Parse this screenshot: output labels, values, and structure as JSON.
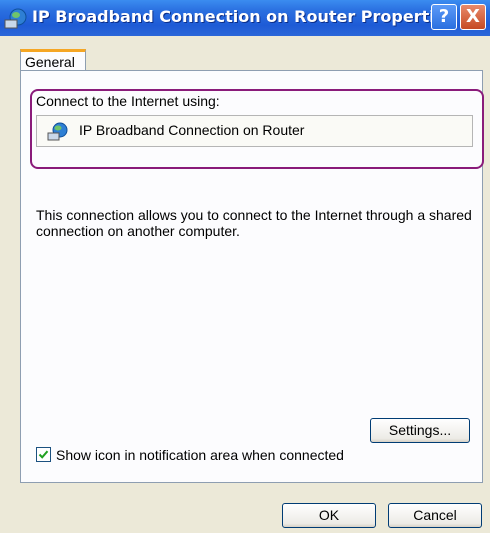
{
  "window": {
    "title": "IP Broadband Connection on Router Properties",
    "title_icon": "network-connection-icon",
    "help_label": "?",
    "close_label": "X"
  },
  "tabs": [
    {
      "label": "General",
      "selected": true
    }
  ],
  "general": {
    "connect_label": "Connect to the Internet using:",
    "connection_name": "IP Broadband Connection on Router",
    "connection_icon": "network-connection-icon",
    "description": "This connection allows you to connect to the Internet through a shared connection on another computer.",
    "settings_label": "Settings...",
    "show_icon_label": "Show icon in notification area when connected",
    "show_icon_checked": true
  },
  "buttons": {
    "ok": "OK",
    "cancel": "Cancel"
  },
  "colors": {
    "highlight": "#8a1b7a",
    "titlebar": "#2a6fe0",
    "tab_accent": "#f5a623"
  }
}
